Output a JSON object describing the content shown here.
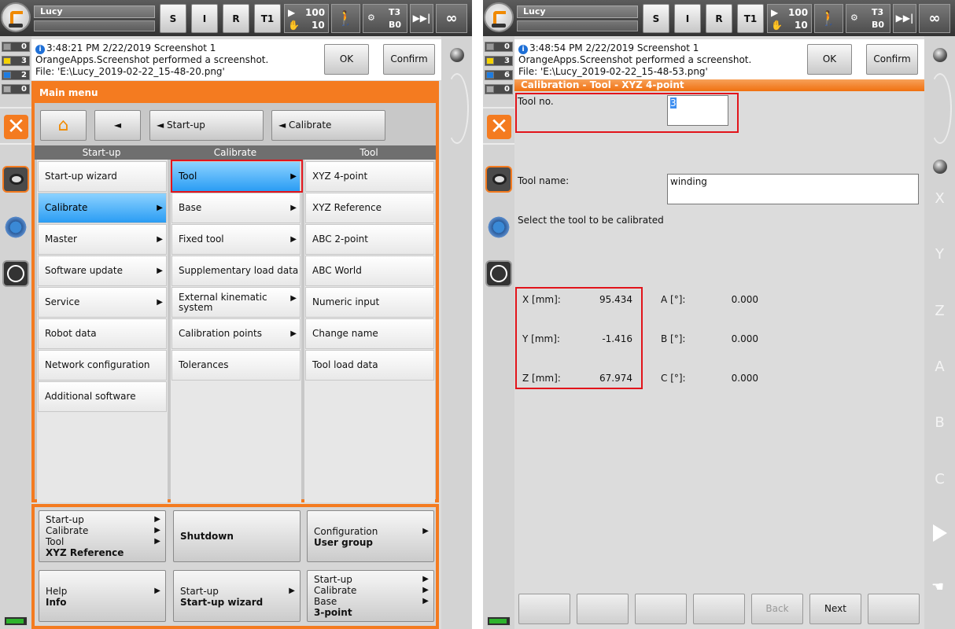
{
  "status_bar": {
    "robot_name": "Lucy",
    "buttons": [
      "S",
      "I",
      "R",
      "T1"
    ],
    "override": {
      "run": "100",
      "jog": "10"
    },
    "tool_base": {
      "tool": "T3",
      "base": "B0"
    },
    "infinity": "∞"
  },
  "message_counts": [
    "0",
    "3",
    "2",
    "0"
  ],
  "message_counts_2": [
    "0",
    "3",
    "6",
    "0"
  ],
  "left": {
    "message": {
      "time": "3:48:21 PM 2/22/2019 Screenshot 1",
      "line2": "OrangeApps.Screenshot performed a screenshot.",
      "line3": "File: 'E:\\Lucy_2019-02-22_15-48-20.png'",
      "ok": "OK",
      "confirm_all": "Confirm all"
    },
    "main_menu_title": "Main menu",
    "nav": {
      "back": "◄",
      "startup": "◄  Start-up",
      "calibrate": "◄  Calibrate"
    },
    "col_headers": [
      "Start-up",
      "Calibrate",
      "Tool"
    ],
    "col1": [
      "Start-up wizard",
      "Calibrate",
      "Master",
      "Software update",
      "Service",
      "Robot data",
      "Network configuration",
      "Additional software"
    ],
    "col2": [
      "Tool",
      "Base",
      "Fixed tool",
      "Supplementary load data",
      "External kinematic\nsystem",
      "Calibration points",
      "Tolerances"
    ],
    "col3": [
      "XYZ 4-point",
      "XYZ Reference",
      "ABC 2-point",
      "ABC World",
      "Numeric input",
      "Change name",
      "Tool load data"
    ],
    "favorites": [
      {
        "lines": [
          "Start-up",
          "Calibrate",
          "Tool"
        ],
        "bold": "XYZ Reference"
      },
      {
        "lines": [],
        "bold": "Shutdown"
      },
      {
        "lines": [
          "Configuration"
        ],
        "bold": "User group"
      },
      {
        "lines": [
          "Help"
        ],
        "bold": "Info"
      },
      {
        "lines": [
          "Start-up"
        ],
        "bold": "Start-up wizard"
      },
      {
        "lines": [
          "Start-up",
          "Calibrate",
          "Base"
        ],
        "bold": "3-point"
      }
    ]
  },
  "right": {
    "message": {
      "time": "3:48:54 PM 2/22/2019 Screenshot 1",
      "line2": "OrangeApps.Screenshot performed a screenshot.",
      "line3": "File: 'E:\\Lucy_2019-02-22_15-48-53.png'",
      "ok": "OK",
      "confirm_all": "Confirm all"
    },
    "header": "Calibration - Tool - XYZ 4-point",
    "tool_no_label": "Tool no.",
    "tool_no_value": "3",
    "tool_name_label": "Tool name:",
    "tool_name_value": "winding",
    "hint": "Select the tool to be calibrated",
    "coords": [
      {
        "label": "X [mm]:",
        "value": "95.434",
        "alabel": "A [°]:",
        "avalue": "0.000"
      },
      {
        "label": "Y [mm]:",
        "value": "-1.416",
        "alabel": "B [°]:",
        "avalue": "0.000"
      },
      {
        "label": "Z [mm]:",
        "value": "67.974",
        "alabel": "C [°]:",
        "avalue": "0.000"
      }
    ],
    "back": "Back",
    "next": "Next"
  },
  "axes": [
    "X",
    "Y",
    "Z",
    "A",
    "B",
    "C"
  ],
  "colors": {
    "accent": "#f47b20",
    "selection": "#2a9df4",
    "highlight": "#e2141b"
  }
}
